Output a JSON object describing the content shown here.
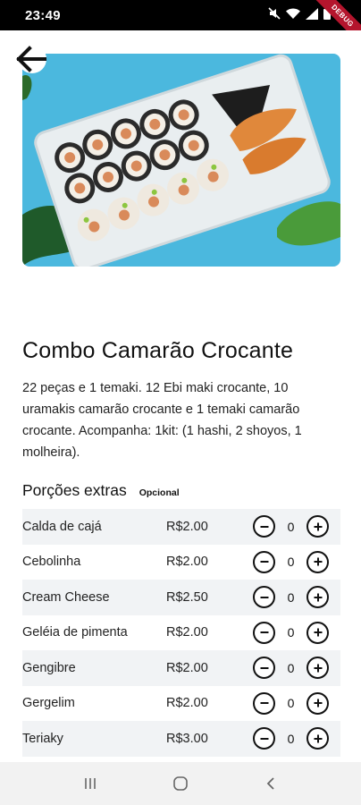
{
  "status_bar": {
    "time": "23:49",
    "debug_banner": "DEBUG",
    "icons": [
      "mute-icon",
      "wifi-icon",
      "signal-icon",
      "battery-icon"
    ]
  },
  "product": {
    "title": "Combo Camarão Crocante",
    "description": "22 peças e 1 temaki. 12 Ebi maki crocante, 10 uramakis camarão crocante e 1 temaki camarão crocante. Acompanha: 1kit: (1 hashi, 2 shoyos, 1 molheira)."
  },
  "extras": {
    "title": "Porções extras",
    "badge": "Opcional",
    "items": [
      {
        "name": "Calda de cajá",
        "price": "R$2.00",
        "quantity": "0"
      },
      {
        "name": "Cebolinha",
        "price": "R$2.00",
        "quantity": "0"
      },
      {
        "name": "Cream Cheese",
        "price": "R$2.50",
        "quantity": "0"
      },
      {
        "name": "Geléia de pimenta",
        "price": "R$2.00",
        "quantity": "0"
      },
      {
        "name": "Gengibre",
        "price": "R$2.00",
        "quantity": "0"
      },
      {
        "name": "Gergelim",
        "price": "R$2.00",
        "quantity": "0"
      },
      {
        "name": "Teriaky",
        "price": "R$3.00",
        "quantity": "0"
      }
    ]
  },
  "colors": {
    "hero_background": "#4bb8de",
    "row_stripe": "#f1f3f5",
    "debug_banner": "#b4152d"
  },
  "nav_bar": {
    "icons": [
      "recent-apps-icon",
      "home-icon",
      "back-nav-icon"
    ]
  }
}
